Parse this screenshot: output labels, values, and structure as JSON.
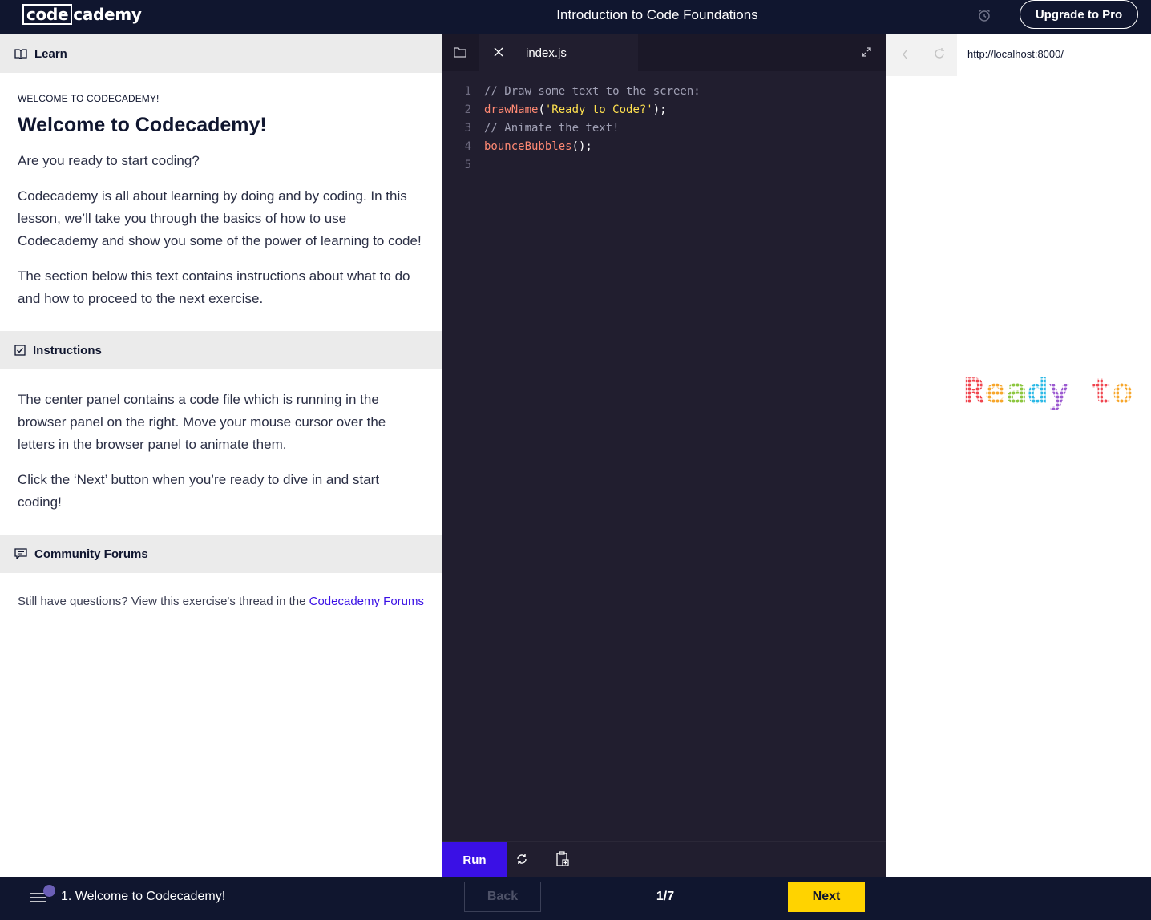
{
  "header": {
    "logo_box": "code",
    "logo_rest": "cademy",
    "course_title": "Introduction to Code Foundations",
    "upgrade_label": "Upgrade to Pro"
  },
  "learn": {
    "tab_label": "Learn",
    "eyebrow": "WELCOME TO CODECADEMY!",
    "title": "Welcome to Codecademy!",
    "paragraphs": [
      "Are you ready to start coding?",
      "Codecademy is all about learning by doing and by coding. In this lesson, we’ll take you through the basics of how to use Codecademy and show you some of the power of learning to code!",
      "The section below this text contains instructions about what to do and how to proceed to the next exercise."
    ]
  },
  "instructions": {
    "label": "Instructions",
    "paragraphs": [
      "The center panel contains a code file which is running in the browser panel on the right. Move your mouse cursor over the letters in the browser panel to animate them.",
      "Click the ‘Next’ button when you’re ready to dive in and start coding!"
    ]
  },
  "forums": {
    "label": "Community Forums",
    "text": "Still have questions? View this exercise's thread in the ",
    "link_text": "Codecademy Forums"
  },
  "editor": {
    "file_name": "index.js",
    "line_numbers": [
      "1",
      "2",
      "3",
      "4",
      "5"
    ],
    "lines": [
      {
        "comment": "// Draw some text to the screen:"
      },
      {
        "fn": "drawName",
        "p1": "(",
        "str": "'Ready to Code?'",
        "p2": ");"
      },
      {
        "comment": "// Animate the text!"
      },
      {
        "fn": "bounceBubbles",
        "p1": "();"
      },
      {}
    ],
    "run_label": "Run"
  },
  "browser": {
    "url": "http://localhost:8000/",
    "canvas_text": "Ready to"
  },
  "footer": {
    "lesson_name": "1. Welcome to Codecademy!",
    "back_label": "Back",
    "progress": "1/7",
    "next_label": "Next"
  },
  "colors": {
    "navy": "#10162f",
    "editor_bg": "#211e2f",
    "run_purple": "#3a10e5",
    "next_yellow": "#ffd300",
    "bubble_colors": [
      "#f0454f",
      "#f7a62b",
      "#8cc63f",
      "#2bb9e6",
      "#9b59d0",
      "#f7a62b"
    ]
  }
}
